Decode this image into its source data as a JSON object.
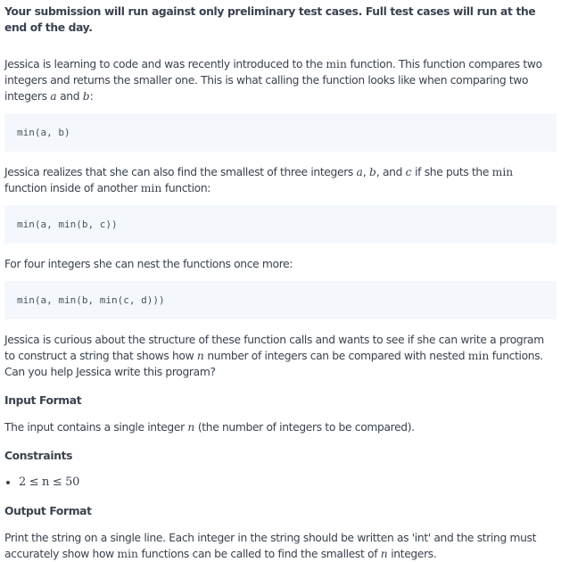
{
  "notice": "Your submission will run against only preliminary test cases. Full test cases will run at the end of the day.",
  "p1": [
    "Jessica is learning to code and was recently introduced to the ",
    "min",
    " function. This function compares two integers and returns the smaller one. This is what calling the function looks like when comparing two integers ",
    "a",
    " and ",
    "b",
    ":"
  ],
  "code1": "min(a, b)",
  "p2": [
    "Jessica realizes that she can also find the smallest of three integers ",
    "a",
    ", ",
    "b",
    ", and ",
    "c",
    " if she puts the ",
    "min",
    " function inside of another ",
    "min",
    " function:"
  ],
  "code2": "min(a, min(b, c))",
  "p3": "For four integers she can nest the functions once more:",
  "code3": "min(a, min(b, min(c, d)))",
  "p4": [
    "Jessica is curious about the structure of these function calls and wants to see if she can write a program to construct a string that shows how ",
    "n",
    " number of integers can be compared with nested ",
    "min",
    " functions. Can you help Jessica write this program?"
  ],
  "input_heading": "Input Format",
  "input_text": [
    "The input contains a single integer ",
    "n",
    " (the number of integers to be compared)."
  ],
  "constraints_heading": "Constraints",
  "constraint": "2 ≤ n ≤ 50",
  "output_heading": "Output Format",
  "output_text": [
    "Print the string on a single line. Each integer in the string should be written as 'int' and the string must accurately show how ",
    "min",
    " functions can be called to find the smallest of ",
    "n",
    " integers."
  ]
}
